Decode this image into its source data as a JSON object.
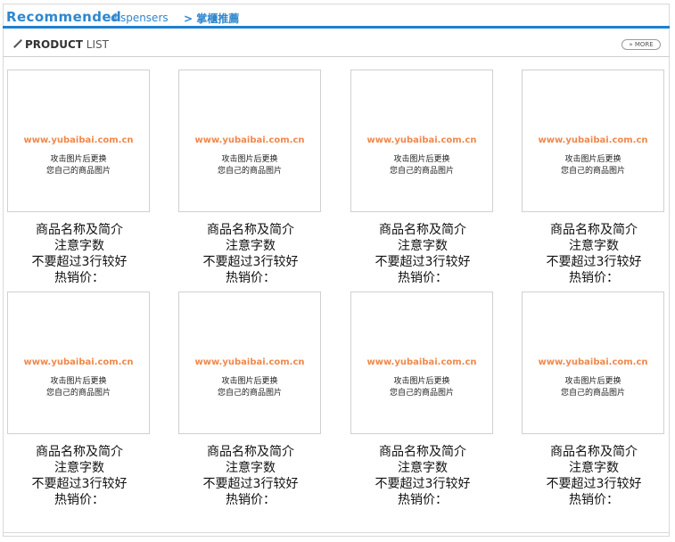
{
  "header": {
    "title_en": "Recommended",
    "title_sub": "dispensers",
    "title_cn": "> 掌櫃推薦"
  },
  "section": {
    "label_bold": "PRODUCT",
    "label_light": "LIST",
    "more_label": "» MORE"
  },
  "products": [
    {
      "watermark_url": "www.yubaibai.com.cn",
      "watermark_line1": "攻击图片后更换",
      "watermark_line2": "您自己的商品图片",
      "name_line1": "商品名称及简介",
      "name_line2": "注意字数",
      "name_line3": "不要超过3行较好",
      "price_label": "热销价："
    },
    {
      "watermark_url": "www.yubaibai.com.cn",
      "watermark_line1": "攻击图片后更换",
      "watermark_line2": "您自己的商品图片",
      "name_line1": "商品名称及简介",
      "name_line2": "注意字数",
      "name_line3": "不要超过3行较好",
      "price_label": "热销价："
    },
    {
      "watermark_url": "www.yubaibai.com.cn",
      "watermark_line1": "攻击图片后更换",
      "watermark_line2": "您自己的商品图片",
      "name_line1": "商品名称及简介",
      "name_line2": "注意字数",
      "name_line3": "不要超过3行较好",
      "price_label": "热销价："
    },
    {
      "watermark_url": "www.yubaibai.com.cn",
      "watermark_line1": "攻击图片后更换",
      "watermark_line2": "您自己的商品图片",
      "name_line1": "商品名称及简介",
      "name_line2": "注意字数",
      "name_line3": "不要超过3行较好",
      "price_label": "热销价："
    },
    {
      "watermark_url": "www.yubaibai.com.cn",
      "watermark_line1": "攻击图片后更换",
      "watermark_line2": "您自己的商品图片",
      "name_line1": "商品名称及简介",
      "name_line2": "注意字数",
      "name_line3": "不要超过3行较好",
      "price_label": "热销价："
    },
    {
      "watermark_url": "www.yubaibai.com.cn",
      "watermark_line1": "攻击图片后更换",
      "watermark_line2": "您自己的商品图片",
      "name_line1": "商品名称及简介",
      "name_line2": "注意字数",
      "name_line3": "不要超过3行较好",
      "price_label": "热销价："
    },
    {
      "watermark_url": "www.yubaibai.com.cn",
      "watermark_line1": "攻击图片后更换",
      "watermark_line2": "您自己的商品图片",
      "name_line1": "商品名称及简介",
      "name_line2": "注意字数",
      "name_line3": "不要超过3行较好",
      "price_label": "热销价："
    },
    {
      "watermark_url": "www.yubaibai.com.cn",
      "watermark_line1": "攻击图片后更换",
      "watermark_line2": "您自己的商品图片",
      "name_line1": "商品名称及简介",
      "name_line2": "注意字数",
      "name_line3": "不要超过3行较好",
      "price_label": "热销价："
    }
  ],
  "colors": {
    "accent": "#2f87cf",
    "watermark": "#f0884a"
  }
}
